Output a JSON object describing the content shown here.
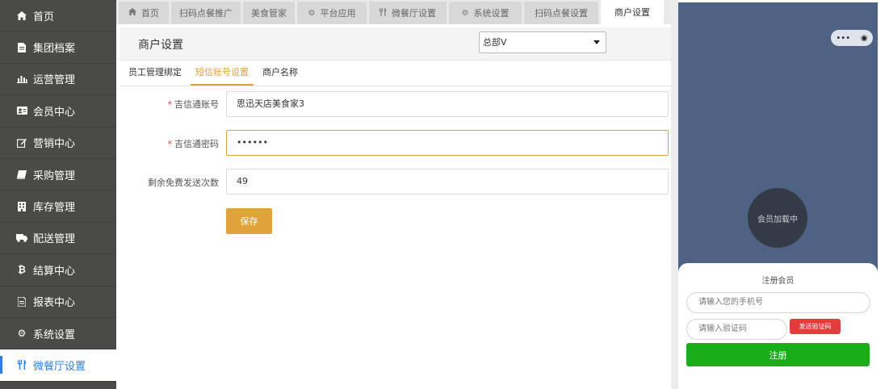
{
  "sidebar": {
    "items": [
      {
        "label": "首页",
        "icon": "home-icon"
      },
      {
        "label": "集团档案",
        "icon": "file-icon"
      },
      {
        "label": "运营管理",
        "icon": "bar-chart-icon"
      },
      {
        "label": "会员中心",
        "icon": "id-card-icon"
      },
      {
        "label": "营销中心",
        "icon": "edit-icon"
      },
      {
        "label": "采购管理",
        "icon": "book-icon"
      },
      {
        "label": "库存管理",
        "icon": "building-icon"
      },
      {
        "label": "配送管理",
        "icon": "truck-icon"
      },
      {
        "label": "结算中心",
        "icon": "bitcoin-icon"
      },
      {
        "label": "报表中心",
        "icon": "report-icon"
      },
      {
        "label": "系统设置",
        "icon": "gears-icon"
      },
      {
        "label": "微餐厅设置",
        "icon": "utensils-icon"
      }
    ],
    "active_index": 11
  },
  "tabs": [
    {
      "label": "首页",
      "icon": "home-icon"
    },
    {
      "label": "扫码点餐推广",
      "icon": ""
    },
    {
      "label": "美食管家",
      "icon": ""
    },
    {
      "label": "平台应用",
      "icon": "gear-icon"
    },
    {
      "label": "微餐厅设置",
      "icon": "utensils-icon"
    },
    {
      "label": "系统设置",
      "icon": "gears-icon"
    },
    {
      "label": "扫码点餐设置",
      "icon": ""
    },
    {
      "label": "商户设置",
      "icon": ""
    }
  ],
  "header": {
    "title": "商户设置",
    "select_value": "总部V"
  },
  "subtabs": [
    "员工管理绑定",
    "短信账号设置",
    "商户名称"
  ],
  "form": {
    "account_label": "吉信通账号",
    "account_value": "思迅天店美食家3",
    "password_label": "吉信通密码",
    "password_value": "••••••",
    "remaining_label": "剩余免费发送次数",
    "remaining_value": "49",
    "required_mark": "*",
    "save_label": "保存"
  },
  "phone": {
    "capsule_more": "•••",
    "capsule_close": "◉",
    "loading_text": "会员加载中",
    "register_title": "注册会员",
    "phone_placeholder": "请输入您的手机号",
    "code_placeholder": "请输入验证码",
    "send_code_label": "发送验证码",
    "register_button": "注册"
  },
  "colors": {
    "sidebar_bg": "#4a4b48",
    "accent": "#e0a33a",
    "active_blue": "#2e7de1",
    "phone_bg": "#4e6283",
    "register_green": "#1aad19",
    "send_code_red": "#e43b3b"
  }
}
